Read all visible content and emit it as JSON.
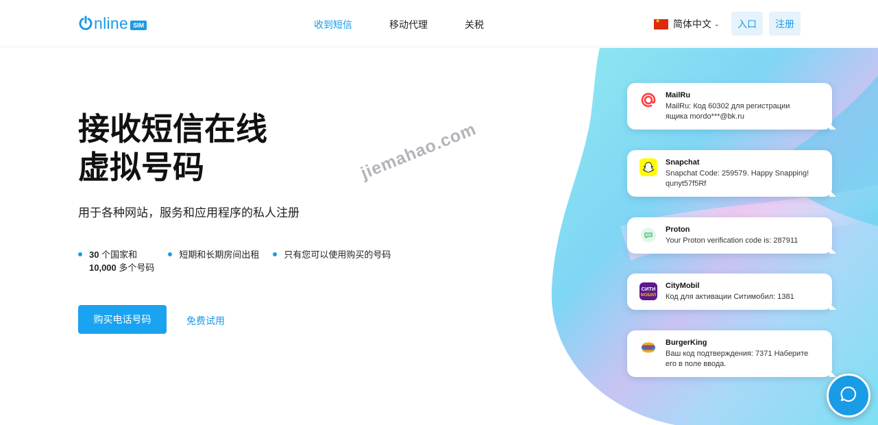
{
  "logo": {
    "text": "nline",
    "badge": "SIM"
  },
  "nav": [
    {
      "label": "收到短信",
      "active": true
    },
    {
      "label": "移动代理",
      "active": false
    },
    {
      "label": "关税",
      "active": false
    }
  ],
  "header": {
    "language": "简体中文",
    "login_label": "入口",
    "register_label": "注册"
  },
  "hero": {
    "title_line1": "接收短信在线",
    "title_line2": "虚拟号码",
    "subtitle": "用于各种网站，服务和应用程序的私人注册",
    "features": [
      {
        "bold1": "30",
        "text1": " 个国家和",
        "bold2": "10,000",
        "text2": " 多个号码"
      },
      {
        "text": "短期和长期房间出租"
      },
      {
        "text": "只有您可以使用购买的号码"
      }
    ],
    "buy_label": "购买电话号码",
    "trial_label": "免费试用"
  },
  "watermark": "jiemahao.com",
  "messages": [
    {
      "service": "MailRu",
      "icon": "mailru-icon",
      "line1": "MailRu: Код 60302 для регистрации",
      "line2": "ящика mordo***@bk.ru"
    },
    {
      "service": "Snapchat",
      "icon": "snapchat-icon",
      "line1": "Snapchat Code: 259579. Happy Snapping!",
      "line2": "qunyt57f5Rf"
    },
    {
      "service": "Proton",
      "icon": "proton-chat-icon",
      "line1": "Your Proton verification code is: 287911",
      "line2": ""
    },
    {
      "service": "CityMobil",
      "icon": "citymobil-icon",
      "line1": "Код для активации Ситимобил: 1381",
      "line2": ""
    },
    {
      "service": "BurgerKing",
      "icon": "burgerking-icon",
      "line1": "Ваш код подтверждения: 7371 Наберите",
      "line2": "его в поле ввода."
    }
  ],
  "citymobil_icon_text": "СИТИ\nМОБИЛ",
  "burgerking_icon_text": "BURGER\nKING",
  "colors": {
    "accent": "#1a9be6",
    "button": "#1aa3f0",
    "citymobil": "#5a1a8c",
    "snapchat": "#fffc00"
  }
}
